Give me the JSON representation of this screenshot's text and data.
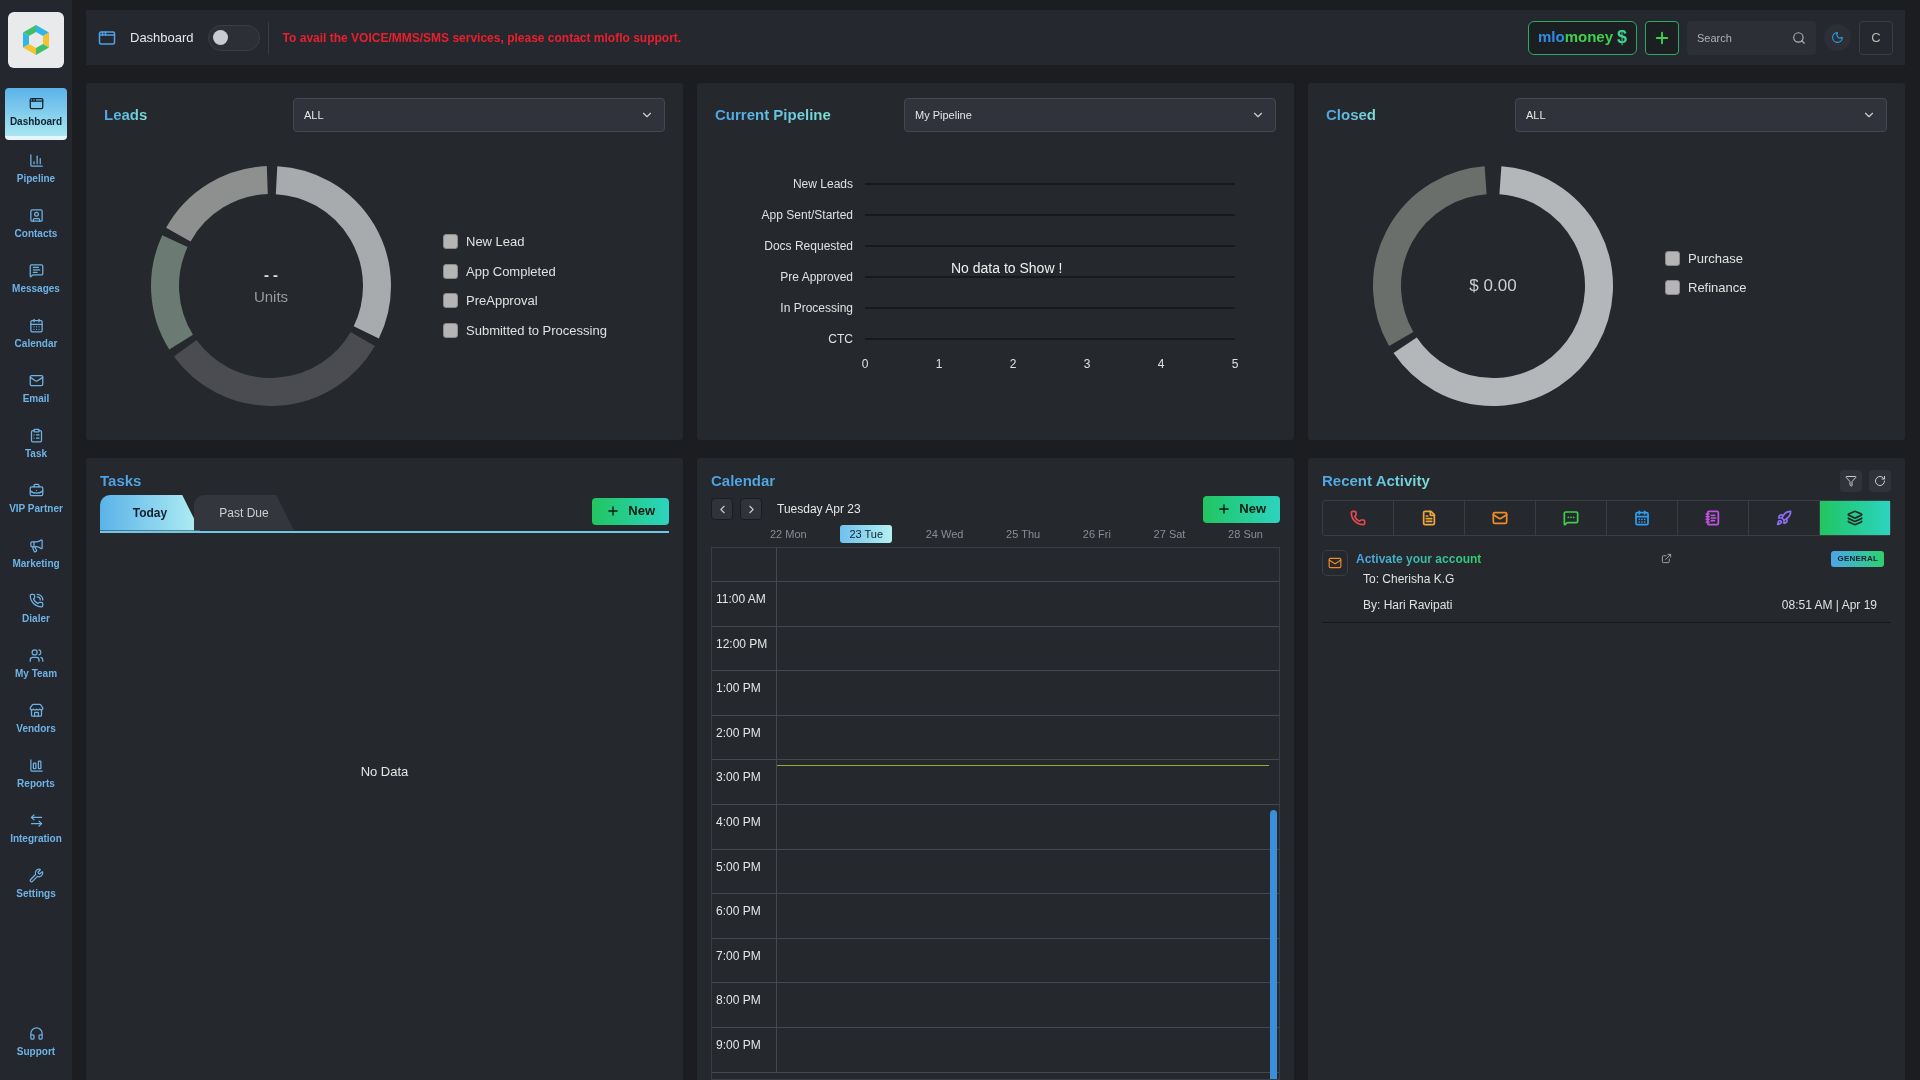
{
  "sidebar": {
    "items": [
      {
        "label": "Dashboard",
        "selected": true
      },
      {
        "label": "Pipeline",
        "selected": false
      },
      {
        "label": "Contacts",
        "selected": false
      },
      {
        "label": "Messages",
        "selected": false
      },
      {
        "label": "Calendar",
        "selected": false
      },
      {
        "label": "Email",
        "selected": false
      },
      {
        "label": "Task",
        "selected": false
      },
      {
        "label": "VIP Partner",
        "selected": false
      },
      {
        "label": "Marketing",
        "selected": false
      },
      {
        "label": "Dialer",
        "selected": false
      },
      {
        "label": "My Team",
        "selected": false
      },
      {
        "label": "Vendors",
        "selected": false
      },
      {
        "label": "Reports",
        "selected": false
      },
      {
        "label": "Integration",
        "selected": false
      },
      {
        "label": "Settings",
        "selected": false
      }
    ],
    "support": "Support"
  },
  "topbar": {
    "title": "Dashboard",
    "toggle_on": false,
    "notice": "To avail the VOICE/MMS/SMS services, please contact mloflo support.",
    "brand": {
      "part1": "mlo",
      "part2": "money",
      "symbol": "$"
    },
    "search": {
      "placeholder": "Search"
    },
    "user_button": "C"
  },
  "leads": {
    "title": "Leads",
    "filter": "ALL",
    "center_value": "- -",
    "center_label": "Units",
    "legend": [
      "New Lead",
      "App Completed",
      "PreApproval",
      "Submitted to Processing"
    ]
  },
  "pipeline": {
    "title": "Current Pipeline",
    "filter": "My Pipeline",
    "empty_message": "No data to Show !",
    "chart_data": {
      "type": "bar",
      "orientation": "horizontal",
      "categories": [
        "New Leads",
        "App Sent/Started",
        "Docs Requested",
        "Pre Approved",
        "In Processing",
        "CTC"
      ],
      "values": [
        null,
        null,
        null,
        null,
        null,
        null
      ],
      "xlim": [
        0,
        5
      ],
      "xticks": [
        0,
        1,
        2,
        3,
        4,
        5
      ]
    }
  },
  "closed": {
    "title": "Closed",
    "filter": "ALL",
    "center_value": "$ 0.00",
    "legend": [
      "Purchase",
      "Refinance"
    ]
  },
  "tasks": {
    "title": "Tasks",
    "tabs": [
      {
        "label": "Today",
        "selected": true
      },
      {
        "label": "Past Due",
        "selected": false
      }
    ],
    "new_button": "New",
    "empty_message": "No Data"
  },
  "calendar": {
    "title": "Calendar",
    "date": "Tuesday Apr 23",
    "new_button": "New",
    "days": [
      {
        "label": "22 Mon",
        "selected": false
      },
      {
        "label": "23 Tue",
        "selected": true
      },
      {
        "label": "24 Wed",
        "selected": false
      },
      {
        "label": "25 Thu",
        "selected": false
      },
      {
        "label": "26 Fri",
        "selected": false
      },
      {
        "label": "27 Sat",
        "selected": false
      },
      {
        "label": "28 Sun",
        "selected": false
      }
    ],
    "hours": [
      "11:00 AM",
      "12:00 PM",
      "1:00 PM",
      "2:00 PM",
      "3:00 PM",
      "4:00 PM",
      "5:00 PM",
      "6:00 PM",
      "7:00 PM",
      "8:00 PM",
      "9:00 PM"
    ]
  },
  "recent_activity": {
    "title": "Recent Activity",
    "filters": [
      {
        "kind": "call",
        "color": "#e5484d",
        "selected": false
      },
      {
        "kind": "document",
        "color": "#f0a63a",
        "selected": false
      },
      {
        "kind": "email",
        "color": "#f08a24",
        "selected": false
      },
      {
        "kind": "message",
        "color": "#3ccf4e",
        "selected": false
      },
      {
        "kind": "calendar",
        "color": "#2f9cf0",
        "selected": false
      },
      {
        "kind": "note",
        "color": "#c054e0",
        "selected": false
      },
      {
        "kind": "rocket",
        "color": "#8b6cf0",
        "selected": false
      },
      {
        "kind": "layers",
        "color": "#1f2a24",
        "selected": true
      }
    ],
    "items": [
      {
        "title": "Activate your account",
        "to": "To: Cherisha K.G",
        "by": "By: Hari Ravipati",
        "time": "08:51 AM | Apr 19",
        "tag": "GENERAL"
      }
    ]
  }
}
